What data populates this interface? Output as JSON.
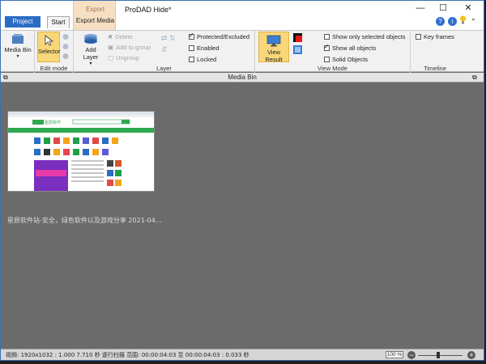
{
  "app": {
    "title": "ProDAD Hide*",
    "tabs": {
      "project": "Project",
      "start": "Start",
      "export_group": "Export",
      "export_media": "Export Media"
    }
  },
  "ribbon": {
    "media_bin": {
      "label": "Media Bin"
    },
    "edit_mode": {
      "selector": "Selector",
      "group_label": "Edit mode"
    },
    "layer": {
      "add_layer": "Add Layer",
      "delete": "Delete",
      "add_to_group": "Add to group",
      "ungroup": "Ungroup",
      "protected_excluded": "Protected/Excluded",
      "enabled": "Enabled",
      "locked": "Locked",
      "group_label": "Layer"
    },
    "view_mode": {
      "view_result": "View Result",
      "show_only_selected": "Show only selected objects",
      "show_all": "Show all objects",
      "solid_objects": "Solid Objects",
      "group_label": "View Mode"
    },
    "timeline": {
      "key_frames": "Key frames",
      "group_label": "Timeline"
    }
  },
  "checkboxes": {
    "protected_excluded": true,
    "enabled": false,
    "locked": false,
    "show_only_selected": false,
    "show_all": true,
    "solid_objects": false,
    "key_frames": false
  },
  "media_bin": {
    "title": "Media Bin",
    "item_caption": "星辰软件站-安全，绿色软件以及游戏分享  2021-04...",
    "thumb": {
      "site_name": "星辰软件"
    }
  },
  "status": {
    "text": "视频: 1920x1032 : 1.000  7.710 秒  逐行扫描  范围: 00:00:04:03 至 00:00:04:03 : 0.033 秒",
    "zoom": "100 %"
  },
  "colors": {
    "accent": "#2b6cc4",
    "export_tab": "#f6dfc3",
    "selector_active": "#f8d77a",
    "panel_bg": "#6b6b6b"
  }
}
